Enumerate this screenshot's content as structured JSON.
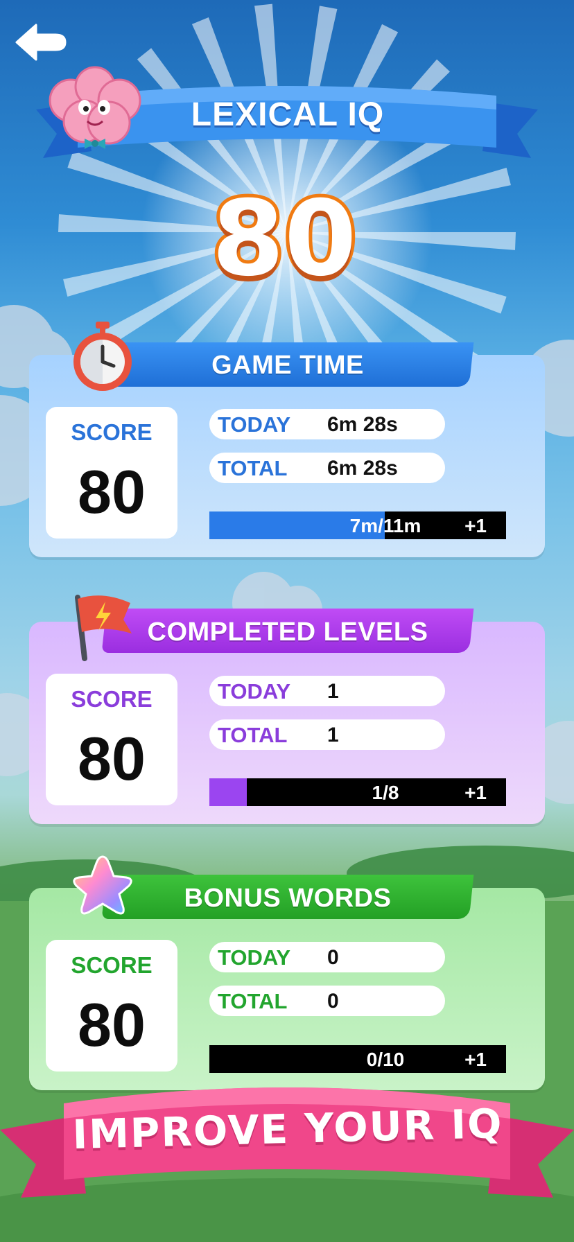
{
  "header": {
    "title": "LEXICAL IQ",
    "iq_value": "80",
    "back_icon": "back-arrow-icon"
  },
  "sections": [
    {
      "id": "game_time",
      "title": "GAME TIME",
      "icon": "stopwatch-icon",
      "score_label": "SCORE",
      "score_value": "80",
      "today_label": "TODAY",
      "today_value": "6m 28s",
      "total_label": "TOTAL",
      "total_value": "6m 28s",
      "progress_text": "7m/11m",
      "progress_fraction": 0.59,
      "reward": "+1",
      "accent": "#2a73d9",
      "fill_color": "#2a7be8"
    },
    {
      "id": "completed_levels",
      "title": "COMPLETED LEVELS",
      "icon": "flag-icon",
      "score_label": "SCORE",
      "score_value": "80",
      "today_label": "TODAY",
      "today_value": "1",
      "total_label": "TOTAL",
      "total_value": "1",
      "progress_text": "1/8",
      "progress_fraction": 0.125,
      "reward": "+1",
      "accent": "#8a3ddb",
      "fill_color": "#9b45f0"
    },
    {
      "id": "bonus_words",
      "title": "BONUS WORDS",
      "icon": "star-icon",
      "score_label": "SCORE",
      "score_value": "80",
      "today_label": "TODAY",
      "today_value": "0",
      "total_label": "TOTAL",
      "total_value": "0",
      "progress_text": "0/10",
      "progress_fraction": 0,
      "reward": "+1",
      "accent": "#22a52e",
      "fill_color": "#2fb83a"
    }
  ],
  "cta": {
    "label": "IMPROVE YOUR IQ"
  }
}
